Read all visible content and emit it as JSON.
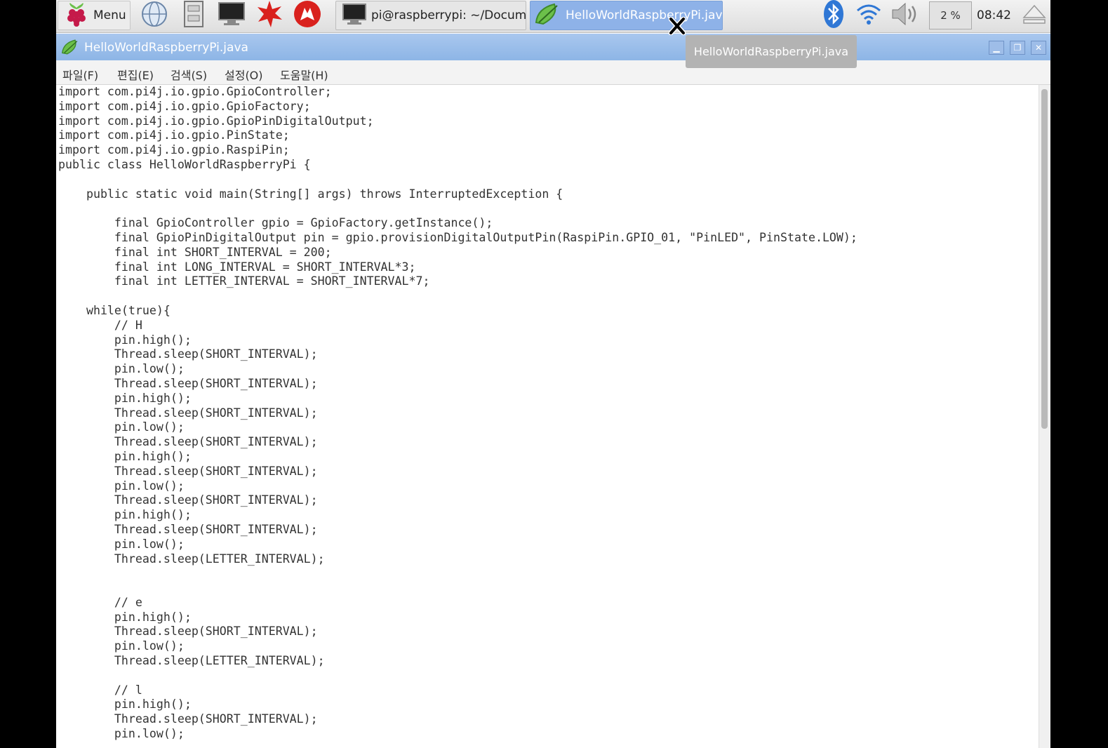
{
  "taskbar": {
    "menu_label": "Menu",
    "tasks": [
      {
        "label": "pi@raspberrypi: ~/Docume..."
      },
      {
        "label": "HelloWorldRaspberryPi.java"
      }
    ],
    "cpu": "2 %",
    "clock": "08:42",
    "tooltip": "HelloWorldRaspberryPi.java"
  },
  "window": {
    "title": "HelloWorldRaspberryPi.java",
    "menu": [
      "파일(F)",
      "편집(E)",
      "검색(S)",
      "설정(O)",
      "도움말(H)"
    ]
  },
  "editor": {
    "code": "import com.pi4j.io.gpio.GpioController;\nimport com.pi4j.io.gpio.GpioFactory;\nimport com.pi4j.io.gpio.GpioPinDigitalOutput;\nimport com.pi4j.io.gpio.PinState;\nimport com.pi4j.io.gpio.RaspiPin;\npublic class HelloWorldRaspberryPi {\n\n    public static void main(String[] args) throws InterruptedException {\n\n        final GpioController gpio = GpioFactory.getInstance();\n        final GpioPinDigitalOutput pin = gpio.provisionDigitalOutputPin(RaspiPin.GPIO_01, \"PinLED\", PinState.LOW);\n        final int SHORT_INTERVAL = 200;\n        final int LONG_INTERVAL = SHORT_INTERVAL*3;\n        final int LETTER_INTERVAL = SHORT_INTERVAL*7;\n\n    while(true){\n        // H\n        pin.high();\n        Thread.sleep(SHORT_INTERVAL);\n        pin.low();\n        Thread.sleep(SHORT_INTERVAL);\n        pin.high();\n        Thread.sleep(SHORT_INTERVAL);\n        pin.low();\n        Thread.sleep(SHORT_INTERVAL);\n        pin.high();\n        Thread.sleep(SHORT_INTERVAL);\n        pin.low();\n        Thread.sleep(SHORT_INTERVAL);\n        pin.high();\n        Thread.sleep(SHORT_INTERVAL);\n        pin.low();\n        Thread.sleep(LETTER_INTERVAL);\n\n\n        // e\n        pin.high();\n        Thread.sleep(SHORT_INTERVAL);\n        pin.low();\n        Thread.sleep(LETTER_INTERVAL);\n\n        // l\n        pin.high();\n        Thread.sleep(SHORT_INTERVAL);\n        pin.low();"
  },
  "colors": {
    "titlebar": "#8db5e6",
    "active_task": "#8eb2e8",
    "raspberry": "#c51a4a",
    "leaf": "#6cc04a"
  }
}
